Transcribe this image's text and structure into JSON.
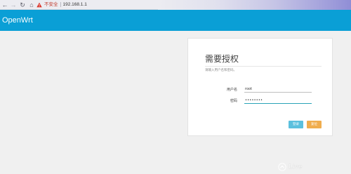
{
  "browser": {
    "back_icon": "arrow-left-icon",
    "forward_icon": "arrow-right-icon",
    "reload_icon": "reload-icon",
    "home_icon": "home-icon",
    "security_icon": "warning-triangle-icon",
    "security_label": "不安全",
    "url": "192.168.1.1",
    "accent_colors": {
      "warning": "#c0392b",
      "strip_end": "#908ed6"
    }
  },
  "header": {
    "brand": "OpenWrt",
    "color": "#0a9fd6"
  },
  "login": {
    "title": "需要授权",
    "hint": "请输入用户名和密码。",
    "username_label": "用户名",
    "username_value": "root",
    "password_label": "密码",
    "password_value": "••••••••",
    "login_button": "登录",
    "reset_button": "复位",
    "login_color": "#5bc0de",
    "reset_color": "#f0ad4e"
  },
  "watermark": {
    "text": "Live",
    "mark_icon": "watermark-logo-icon"
  }
}
